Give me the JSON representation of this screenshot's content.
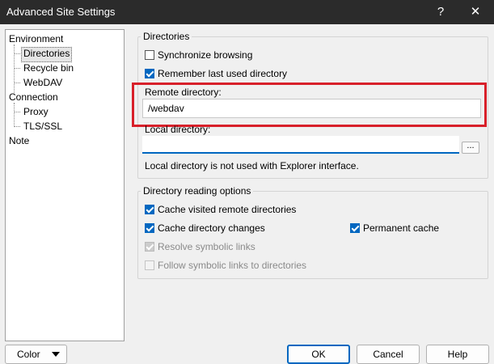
{
  "window": {
    "title": "Advanced Site Settings",
    "help_glyph": "?",
    "close_glyph": "✕"
  },
  "tree": {
    "environment": "Environment",
    "directories": "Directories",
    "recycle_bin": "Recycle bin",
    "webdav": "WebDAV",
    "connection": "Connection",
    "proxy": "Proxy",
    "tls_ssl": "TLS/SSL",
    "note": "Note"
  },
  "directories": {
    "group_label": "Directories",
    "sync_browsing": {
      "label": "Synchronize browsing",
      "checked": false
    },
    "remember_last": {
      "label": "Remember last used directory",
      "checked": true
    },
    "remote_label": "Remote directory:",
    "remote_value": "/webdav",
    "local_label": "Local directory:",
    "local_value": "",
    "browse_label": "...",
    "local_note": "Local directory is not used with Explorer interface."
  },
  "reading": {
    "group_label": "Directory reading options",
    "cache_visited": {
      "label": "Cache visited remote directories",
      "checked": true
    },
    "cache_changes": {
      "label": "Cache directory changes",
      "checked": true
    },
    "permanent_cache": {
      "label": "Permanent cache",
      "checked": true
    },
    "resolve_links": {
      "label": "Resolve symbolic links",
      "checked": true,
      "disabled": true
    },
    "follow_links": {
      "label": "Follow symbolic links to directories",
      "checked": false,
      "disabled": true
    }
  },
  "footer": {
    "color_label": "Color",
    "ok_label": "OK",
    "cancel_label": "Cancel",
    "help_label": "Help"
  },
  "colors": {
    "accent": "#0067c0",
    "highlight": "#d8202a",
    "titlebar": "#2b2b2b"
  }
}
